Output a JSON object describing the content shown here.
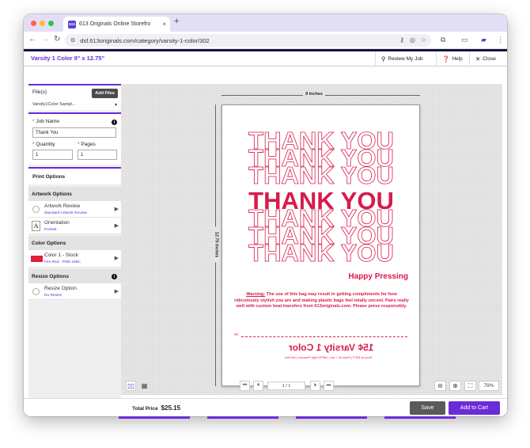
{
  "browser": {
    "tab_title": "613 Originals Online Storefro",
    "favicon_text": "613",
    "url": "dsf.613originals.com/category/varsity-1-color/302"
  },
  "header": {
    "title": "Varsity 1 Color 9\" x 12.75\"",
    "review_label": "Review My Job",
    "help_label": "Help",
    "close_label": "Close"
  },
  "sidebar": {
    "files_label": "File(s)",
    "add_files_label": "Add Files",
    "file_select_value": "Varsity1Color Sampl...",
    "job_name_label": "Job Name",
    "job_name_value": "Thank You",
    "quantity_label": "Quantity",
    "quantity_value": "1",
    "pages_label": "Pages",
    "pages_value": "1",
    "required_marker": "*",
    "print_options_label": "Print Options",
    "artwork_options_label": "Artwork Options",
    "artwork_review_label": "Artwork Review",
    "artwork_review_sub": "Standard Artwork Review",
    "orientation_label": "Orientation",
    "orientation_sub": "Portrait",
    "orientation_icon": "A",
    "color_options_label": "Color Options",
    "color_label": "Color 1 - Stock",
    "color_sub": "Fire Red - PMS 199C",
    "color_swatch": "#e2203c",
    "resize_options_label": "Resize Options",
    "resize_label": "Resize Option",
    "resize_sub": "No Resize"
  },
  "preview": {
    "width_label": "9 Inches",
    "height_label": "12.75 Inches",
    "thank_you_lines": [
      "THANK YOU",
      "THANK YOU",
      "THANK YOU",
      "THANK YOU",
      "THANK YOU",
      "THANK YOU",
      "THANK YOU"
    ],
    "happy_pressing": "Happy Pressing",
    "warning_title": "Warning:",
    "warning_text": " The use of this bag may result in getting compliments for how ridiculously stylish you are and making plastic bags feel totally uncool. Pairs really well with custom heat transfers from 613originals.com. Please press responsibly.",
    "mirrored_title": "15¢ Varsity 1 Color",
    "mirrored_sub": "Temp at 325°F | Press for 7 sec. | 60PSI High Pressure | Hot Peel.",
    "brand_color": "#d81b4c"
  },
  "viewer": {
    "page_indicator": "1 / 1",
    "zoom": "79%"
  },
  "footer": {
    "total_label": "Total Price",
    "total_value": "$25.15",
    "save_label": "Save",
    "add_to_cart_label": "Add to Cart"
  }
}
